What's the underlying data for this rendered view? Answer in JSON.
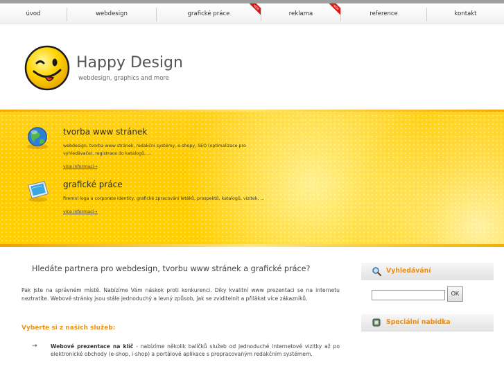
{
  "nav": {
    "items": [
      {
        "label": "úvod",
        "badge": ""
      },
      {
        "label": "webdesign",
        "badge": ""
      },
      {
        "label": "grafické práce",
        "badge": "NEW"
      },
      {
        "label": "reklama",
        "badge": "NEW"
      },
      {
        "label": "reference",
        "badge": ""
      },
      {
        "label": "kontakt",
        "badge": ""
      }
    ]
  },
  "logo": {
    "title": "Happy Design",
    "subtitle": "webdesign, graphics and more"
  },
  "banner": {
    "services": [
      {
        "title": "tvorba www stránek",
        "text": "webdesign, tvorba www stránek, redakční systémy, e-shopy, SEO (optimalizace pro vyhledávače), registrace do katalogů, ...",
        "link": "více informací",
        "icon": "globe-icon"
      },
      {
        "title": "grafické práce",
        "text": "firemní loga a corporate identity, grafické zpracování letáků, prospektů, katalogů, vizitek, ...",
        "link": "více informací",
        "icon": "monitor-icon"
      }
    ]
  },
  "main": {
    "title": "Hledáte partnera pro webdesign, tvorbu www stránek a grafické práce?",
    "intro": "Pak jste na správném místě. Nabízíme Vám náskok proti konkurenci. Díky kvalitní www prezentaci se na internetu neztratíte. Webové stránky jsou stále jednoduchý a levný způsob, jak se zviditelnit a přilákat více zákazníků.",
    "services_heading": "Vyberte si z našich služeb:",
    "bullets": [
      {
        "bold": "Webové prezentace na klíč",
        "text": " - nabízíme několik balíčků služeb od jednoduché internetové vizitky až po elektronické obchody (e-shop, i-shop) a portálové aplikace s propracovaným redakčním systémem."
      }
    ]
  },
  "sidebar": {
    "search": {
      "title": "Vyhledávání",
      "icon": "magnifier-icon",
      "input_value": "",
      "button": "OK"
    },
    "special": {
      "title": "Speciální nabídka",
      "icon": "chip-icon"
    }
  },
  "colors": {
    "accent": "#e8951b",
    "banner": "#ffcc00",
    "badge": "#d81515"
  }
}
